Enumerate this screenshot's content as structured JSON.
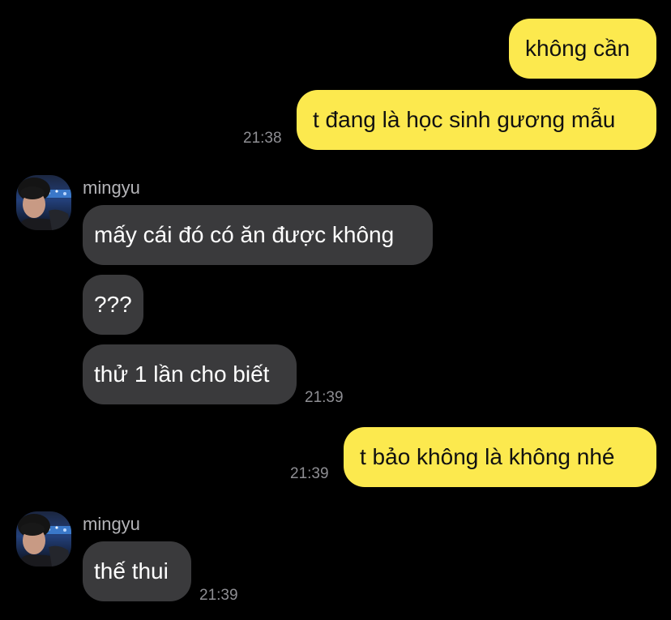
{
  "messages": {
    "m1": {
      "text": "không cần"
    },
    "m2": {
      "text": "t đang là học sinh gương mẫu",
      "time": "21:38"
    },
    "group1": {
      "sender": "mingyu"
    },
    "m3": {
      "text": "mấy cái đó có ăn được không"
    },
    "m4": {
      "text": "???"
    },
    "m5": {
      "text": "thử 1 lần cho biết",
      "time": "21:39"
    },
    "m6": {
      "text": "t bảo không là không nhé",
      "time": "21:39"
    },
    "group2": {
      "sender": "mingyu"
    },
    "m7": {
      "text": "thế thui",
      "time": "21:39"
    }
  },
  "colors": {
    "background": "#000000",
    "outgoing_bubble": "#fce94e",
    "incoming_bubble": "#3a3a3c",
    "timestamp": "#8e8e93",
    "sender_name": "#b4b4b8"
  },
  "icons": {
    "avatar": "profile-photo"
  }
}
